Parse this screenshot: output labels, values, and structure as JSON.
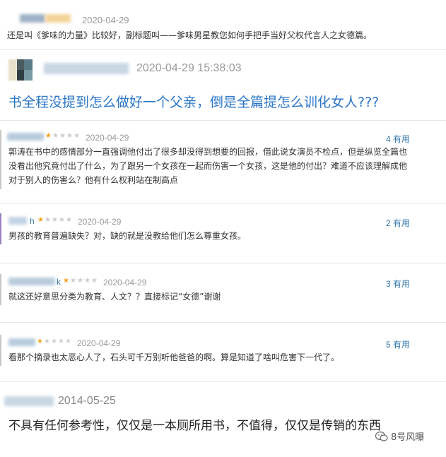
{
  "review1": {
    "date": "2020-04-29",
    "text": "还是叫《爹味的力量》比较好，副标题叫——爹味男星教您如何手把手当好父权代言人之女德篇。"
  },
  "review2": {
    "datetime": "2020-04-29 15:38:03",
    "headline": "书全程没提到怎么做好一个父亲，倒是全篇提怎么训化女人???"
  },
  "comments": [
    {
      "user_fragment": "",
      "date": "2020-04-29",
      "useful": "4 有用",
      "lines": [
        "郭涛在书中的感情部分一直强调他付出了很多却没得到想要的回报，借此说女演员不检点，但是纵览全篇也",
        "没看出他究竟付出了什么，为了跟另一个女孩在一起而伤害一个女孩，这是他的付出？难道不应该理解成他",
        "对于别人的伤害么？他有什么权利站在制高点"
      ]
    },
    {
      "user_fragment": "h",
      "date": "2020-04-29",
      "useful": "2 有用",
      "lines": [
        "男孩的教育普遍缺失？对，缺的就是没教给他们怎么尊重女孩。"
      ]
    },
    {
      "user_fragment": "k",
      "date": "2020-04-29",
      "useful": "3 有用",
      "lines": [
        "就这还好意思分类为教育、人文？？直接标记“女德”谢谢"
      ]
    },
    {
      "user_fragment": "",
      "date": "2020-04-29",
      "useful": "5 有用",
      "lines": [
        "看那个摘录也太恶心人了，石头可千万别听他爸爸的啊。算是知道了啥叫危害下一代了。"
      ]
    }
  ],
  "review3": {
    "date": "2014-05-25",
    "text": "不具有任何参考性，仅仅是一本厕所用书，不值得，仅仅是传销的东西"
  },
  "watermark": {
    "label": "8号风曝"
  },
  "colors": {
    "link_blue": "#3377aa",
    "star_on": "#f4a41f",
    "headline_blue": "#2a76c6"
  }
}
